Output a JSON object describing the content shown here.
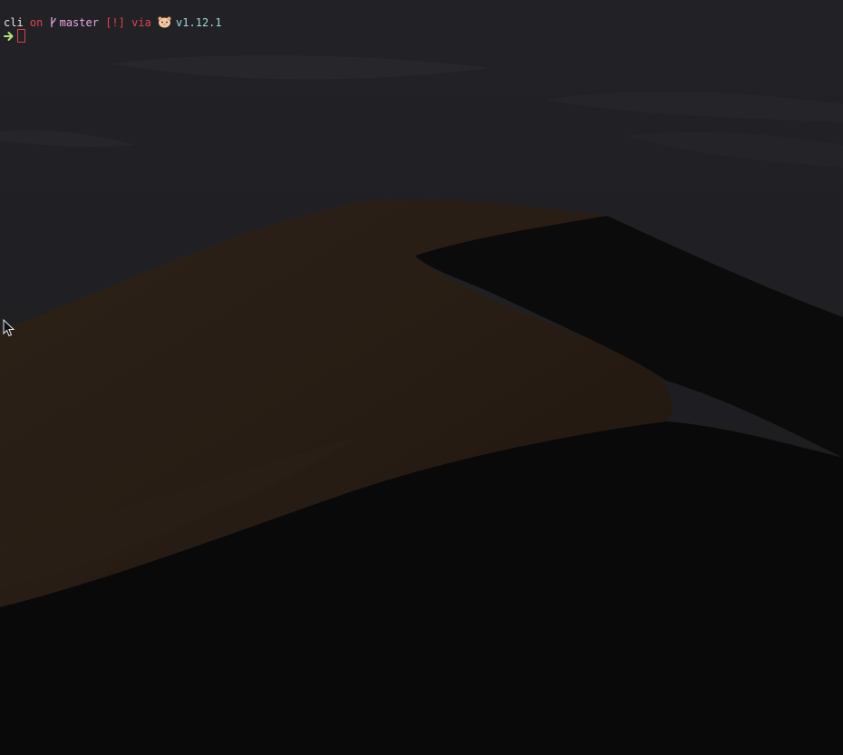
{
  "terminal": {
    "prompt": {
      "directory": "cli",
      "on_word": "on",
      "branch_icon": "git-branch-icon",
      "branch": "master",
      "status": "[!]",
      "via_word": "via",
      "runtime_icon": "hamster-icon",
      "version": "v1.12.1"
    },
    "input_line": {
      "arrow_icon": "arrow-right-icon",
      "command": ""
    }
  },
  "desktop": {
    "wallpaper": "desert-dunes-night"
  },
  "colors": {
    "directory": "#e6e6e6",
    "on_word": "#e0434f",
    "branch": "#e6a8e0",
    "status": "#e0434f",
    "via_word": "#e0434f",
    "version": "#9fd8dc",
    "arrow": "#b6e27a",
    "cursor": "#d7434b"
  }
}
